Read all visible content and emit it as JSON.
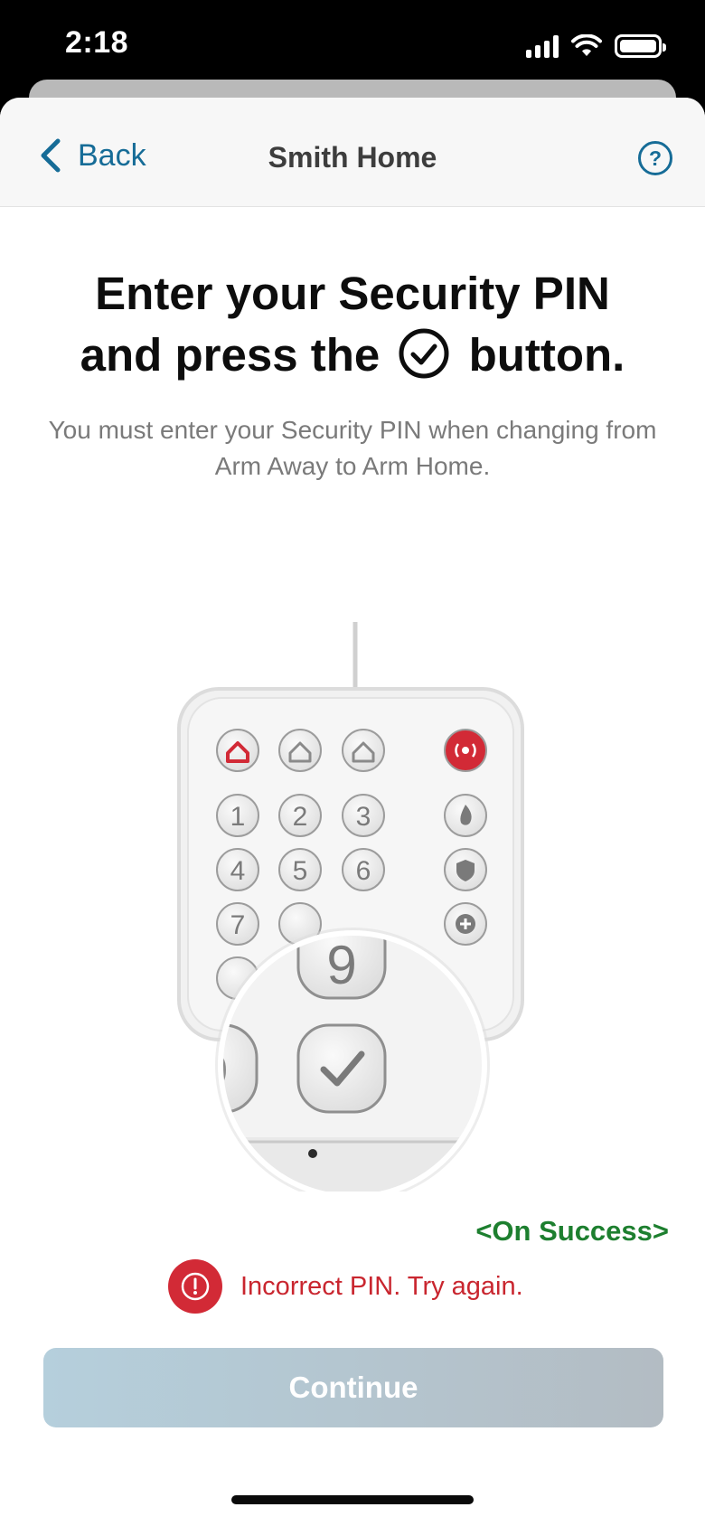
{
  "status_bar": {
    "time": "2:18"
  },
  "nav": {
    "back_label": "Back",
    "title": "Smith Home",
    "help_symbol": "?"
  },
  "content": {
    "heading_line1": "Enter your Security PIN",
    "heading_line2_before": "and press the",
    "heading_line2_after": "button.",
    "subtext": "You must enter your Security PIN when changing from Arm Away to Arm Home."
  },
  "keypad": {
    "number_keys": [
      "1",
      "2",
      "3",
      "4",
      "5",
      "6",
      "7"
    ],
    "zoom_key": "9"
  },
  "success_label": "<On Success>",
  "error": {
    "message": "Incorrect PIN. Try again.",
    "icon_glyph": "!"
  },
  "continue_label": "Continue",
  "colors": {
    "accent": "#166c97",
    "error": "#d22a36",
    "success": "#1d7f2f",
    "button_disabled": "#b5cfdc"
  },
  "icons": [
    "chevron-left-icon",
    "help-icon",
    "check-circle-icon",
    "error-icon",
    "cellular-signal-icon",
    "wifi-icon",
    "battery-icon"
  ]
}
